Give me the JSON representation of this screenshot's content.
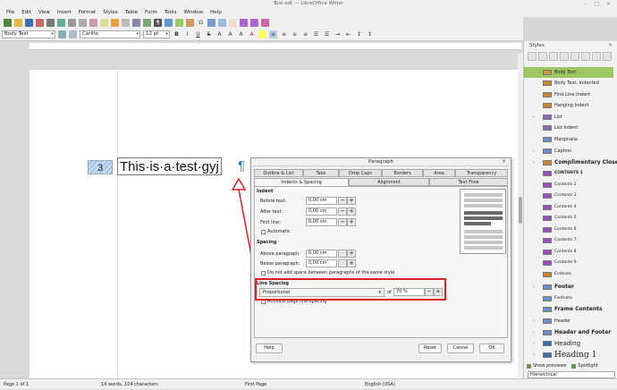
{
  "window": {
    "title": "Test.odt — LibreOffice Writer"
  },
  "menu": [
    "File",
    "Edit",
    "View",
    "Insert",
    "Format",
    "Styles",
    "Table",
    "Form",
    "Tools",
    "Window",
    "Help"
  ],
  "toolbar": {
    "style": "Body Text",
    "font": "Carlito",
    "size": "12 pt"
  },
  "document": {
    "list_number": "3",
    "text": "This·is·a·test·gyj",
    "pilcrow": "¶"
  },
  "dialog": {
    "title": "Paragraph",
    "tabs_row1": [
      "Outline & List",
      "Tabs",
      "Drop Caps",
      "Borders",
      "Area",
      "Transparency"
    ],
    "tabs_row2": [
      "Indents & Spacing",
      "Alignment",
      "Text Flow"
    ],
    "indent": {
      "heading": "Indent",
      "before_label": "Before text:",
      "before_value": "0,00 cm",
      "after_label": "After text:",
      "after_value": "0,00 cm",
      "first_label": "First line:",
      "first_value": "0,00 cm",
      "automatic": "Automatic"
    },
    "spacing": {
      "heading": "Spacing",
      "above_label": "Above paragraph:",
      "above_value": "0,00 cm",
      "below_label": "Below paragraph:",
      "below_value": "0,00 cm",
      "no_space": "Do not add space between paragraphs of the same style"
    },
    "line_spacing": {
      "heading": "Line Spacing",
      "mode": "Proportional",
      "of_label": "of",
      "value": "70 %",
      "register_true": "Activate page line-spacing"
    },
    "buttons": {
      "help": "Help",
      "reset": "Reset",
      "cancel": "Cancel",
      "ok": "OK"
    }
  },
  "sidebar": {
    "title": "Styles",
    "items": [
      {
        "label": "Body Text",
        "selected": true
      },
      {
        "label": "Body Text, Indented"
      },
      {
        "label": "First Line Indent"
      },
      {
        "label": "Hanging Indent"
      },
      {
        "label": "List"
      },
      {
        "label": "List Indent"
      },
      {
        "label": "Marginalia"
      },
      {
        "label": "Caption"
      },
      {
        "label": "Complimentary Close"
      },
      {
        "label": "CONTENTS 1"
      },
      {
        "label": "Contents 2"
      },
      {
        "label": "Contents 3"
      },
      {
        "label": "Contents 4"
      },
      {
        "label": "Contents 5"
      },
      {
        "label": "Contents 6"
      },
      {
        "label": "Contents 7"
      },
      {
        "label": "Contents 8"
      },
      {
        "label": "Contents 9"
      },
      {
        "label": "Endnote"
      },
      {
        "label": "Footer"
      },
      {
        "label": "Footnote"
      },
      {
        "label": "Frame Contents"
      },
      {
        "label": "Header"
      },
      {
        "label": "Header and Footer"
      },
      {
        "label": "Heading"
      },
      {
        "label": "Heading 1"
      }
    ],
    "show_previews": "Show previews",
    "spotlight": "Spotlight",
    "filter": "Hierarchical"
  },
  "status": {
    "page": "Page 1 of 1",
    "words": "14 words, 104 characters",
    "page_style": "First Page",
    "language": "English (USA)"
  }
}
